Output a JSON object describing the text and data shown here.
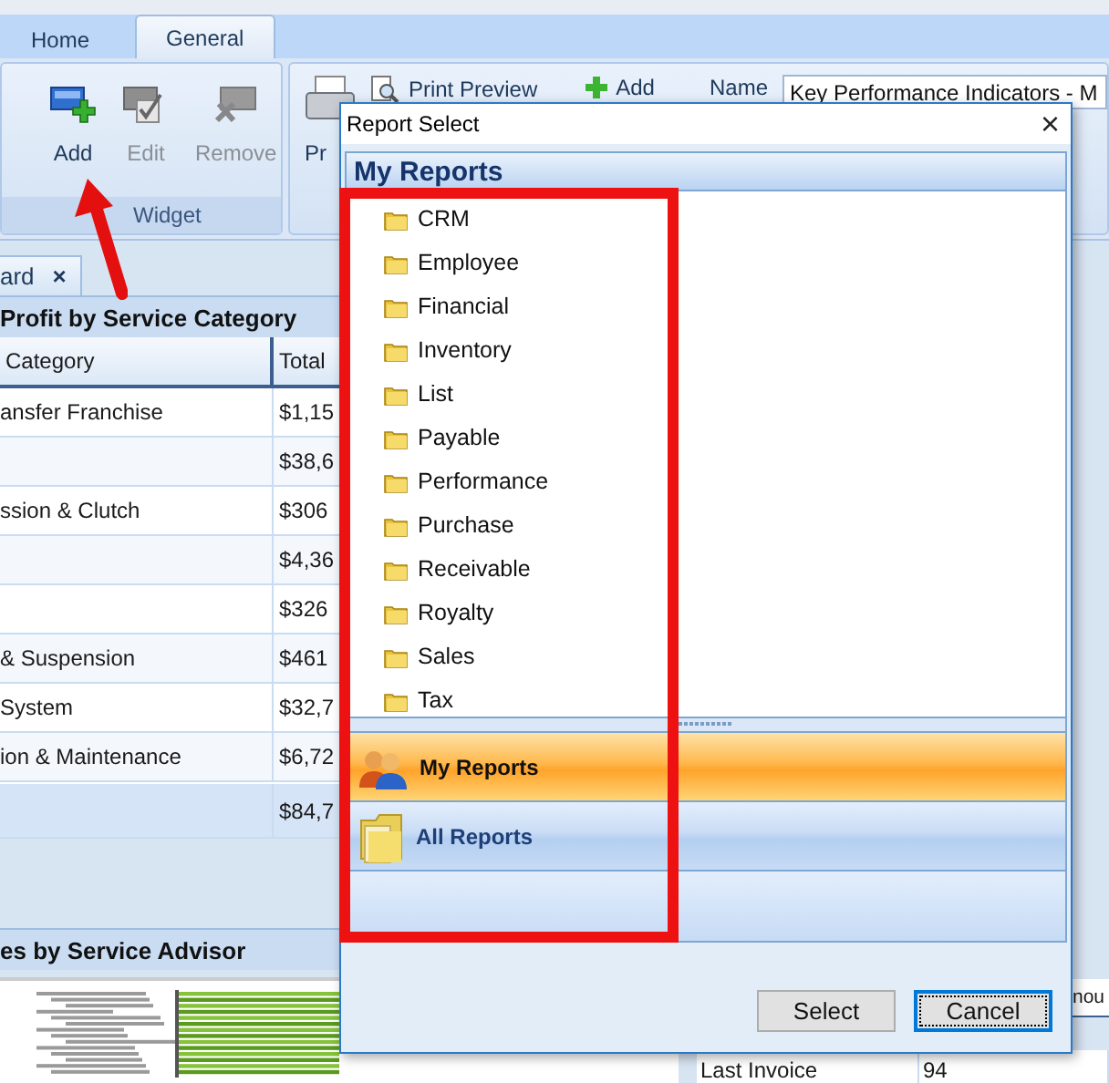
{
  "tabs": [
    {
      "label": "Home",
      "selected": false
    },
    {
      "label": "General",
      "selected": true
    }
  ],
  "ribbon": {
    "widget_buttons": [
      {
        "label": "Add",
        "disabled": false
      },
      {
        "label": "Edit",
        "disabled": true
      },
      {
        "label": "Remove",
        "disabled": true
      }
    ],
    "widget_caption": "Widget",
    "print_label": "Pr",
    "print_preview": "Print Preview",
    "add": "Add",
    "name_label": "Name",
    "name_value": "Key Performance Indicators - M"
  },
  "document_tab": {
    "label": "ard",
    "close": "×"
  },
  "profit_panel": {
    "title": "Profit by Service Category",
    "columns": [
      "Category",
      "Total"
    ],
    "rows": [
      {
        "category": "ansfer Franchise",
        "total": "$1,15"
      },
      {
        "total": "$38,6"
      },
      {
        "category": "ssion & Clutch",
        "total": "$306"
      },
      {
        "total": "$4,36"
      },
      {
        "total": "$326"
      },
      {
        "category": " & Suspension",
        "total": "$461"
      },
      {
        "category": " System",
        "total": "$32,7"
      },
      {
        "category": "ion & Maintenance",
        "total": "$6,72"
      }
    ],
    "total": {
      "total": "$84,7"
    }
  },
  "advisor_panel": {
    "title": "es by Service Advisor"
  },
  "right_panel": {
    "column_3": "nou",
    "rows": [
      [
        "Last Invoice",
        "94"
      ]
    ]
  },
  "dialog": {
    "title": "Report Select",
    "close": "×",
    "header": "My Reports",
    "folders": [
      "CRM",
      "Employee",
      "Financial",
      "Inventory",
      "List",
      "Payable",
      "Performance",
      "Purchase",
      "Receivable",
      "Royalty",
      "Sales",
      "Tax"
    ],
    "nav": [
      {
        "label": "My Reports",
        "selected": true
      },
      {
        "label": "All Reports",
        "selected": false
      }
    ],
    "buttons": [
      {
        "label": "Select",
        "focused": false
      },
      {
        "label": "Cancel",
        "focused": true
      }
    ]
  }
}
